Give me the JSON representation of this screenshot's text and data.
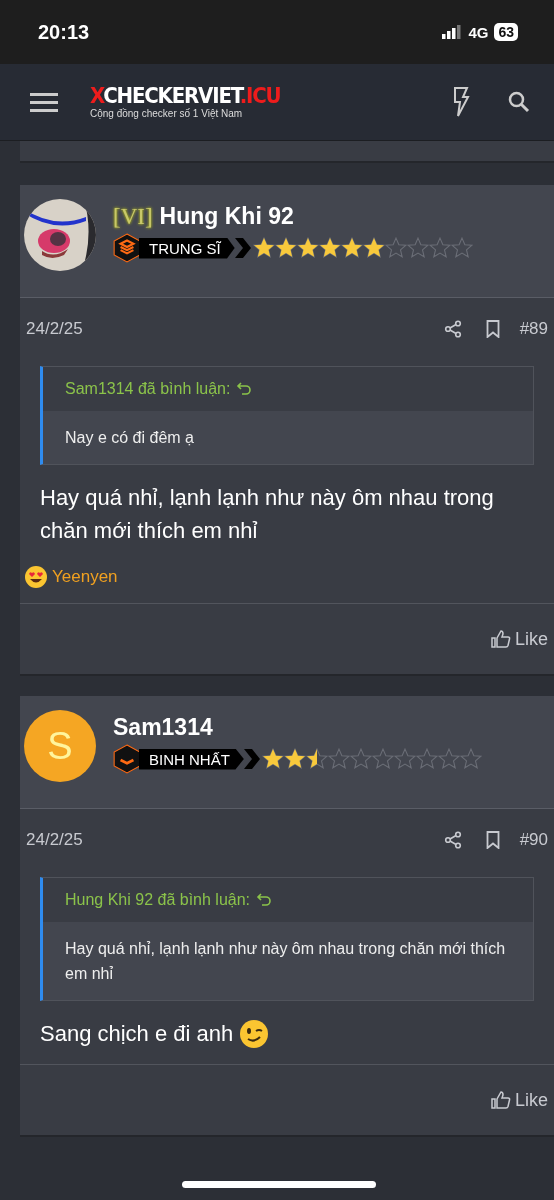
{
  "status_bar": {
    "time": "20:13",
    "network": "4G",
    "battery": "63"
  },
  "header": {
    "logo_parts": [
      {
        "text": "X",
        "color": "#ee1c1c"
      },
      {
        "text": "CHECKERVIET",
        "color": "#ffffff"
      },
      {
        "text": ".ICU",
        "color": "#ee1c1c"
      }
    ],
    "tagline": "Cộng đồng checker số 1 Việt Nam"
  },
  "posts": [
    {
      "prefix": "[VI]",
      "author": "Hung Khi 92",
      "avatar": {
        "kind": "picture"
      },
      "rank": {
        "label": "TRUNG SĨ",
        "kind": "sergeant"
      },
      "stars": 6,
      "date": "24/2/25",
      "number": "#89",
      "quote": {
        "author": "Sam1314 đã bình luận:",
        "text": "Nay e có đi đêm ạ"
      },
      "message": "Hay quá nhỉ, lạnh lạnh như này ôm nhau trong chăn mới thích em nhỉ",
      "reactions": [
        {
          "user": "Yeenyen"
        }
      ],
      "like": "Like"
    },
    {
      "author": "Sam1314",
      "avatar": {
        "kind": "letter",
        "letter": "S"
      },
      "rank": {
        "label": "BINH NHẤT",
        "kind": "private"
      },
      "stars": 2.5,
      "date": "24/2/25",
      "number": "#90",
      "quote": {
        "author": "Hung Khi 92 đã bình luận:",
        "text": "Hay quá nhỉ, lạnh lạnh như này ôm nhau trong chăn mới thích em nhỉ"
      },
      "message": "Sang chịch e đi anh",
      "emoji": {
        "kind": "wink"
      },
      "like": "Like"
    }
  ]
}
